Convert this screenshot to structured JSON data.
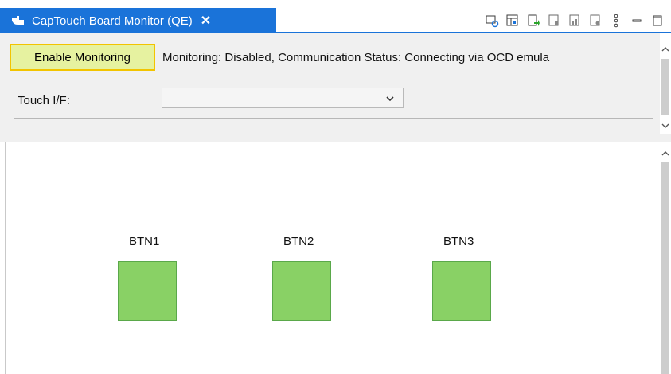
{
  "tab": {
    "title": "CapTouch Board Monitor (QE)",
    "close": "✕",
    "icon": "hand-touch-icon"
  },
  "toolbar": {
    "icons": [
      "refresh-board-icon",
      "table-view-icon",
      "export-icon",
      "save-icon",
      "chart-icon",
      "import-icon",
      "view-menu-icon",
      "minimize-icon",
      "maximize-icon"
    ]
  },
  "monitor": {
    "enable_label": "Enable Monitoring",
    "status": "Monitoring: Disabled, Communication Status: Connecting via OCD emula"
  },
  "touch_if": {
    "label": "Touch I/F:",
    "selected": ""
  },
  "buttons": [
    {
      "label": "BTN1",
      "color": "#89d165"
    },
    {
      "label": "BTN2",
      "color": "#89d165"
    },
    {
      "label": "BTN3",
      "color": "#89d165"
    }
  ],
  "colors": {
    "tab_blue": "#1a73d9",
    "highlight_border": "#f2c400",
    "highlight_fill": "#e6f2a0",
    "button_green": "#89d165"
  }
}
